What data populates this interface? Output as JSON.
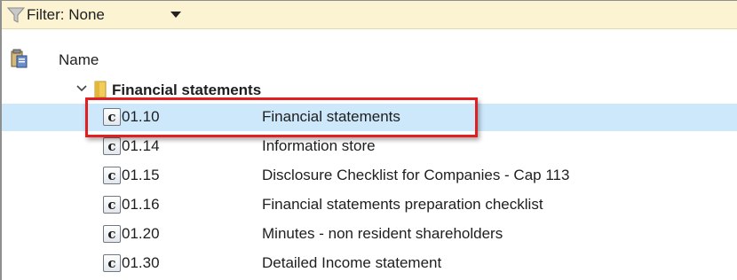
{
  "filter_bar": {
    "label": "Filter: None",
    "icon": "filter-icon"
  },
  "header": {
    "name_label": "Name",
    "icon": "clipboard-icon"
  },
  "group": {
    "label": "Financial statements",
    "icon": "folder-icon",
    "expanded": true
  },
  "rows": [
    {
      "code": "01.10",
      "name": "Financial statements",
      "icon": "c-document-icon",
      "selected": true
    },
    {
      "code": "01.14",
      "name": "Information store",
      "icon": "c-document-icon"
    },
    {
      "code": "01.15",
      "name": "Disclosure Checklist for Companies - Cap 113",
      "icon": "c-document-icon"
    },
    {
      "code": "01.16",
      "name": "Financial statements preparation checklist",
      "icon": "c-document-icon"
    },
    {
      "code": "01.20",
      "name": "Minutes - non resident shareholders",
      "icon": "c-document-icon"
    },
    {
      "code": "01.30",
      "name": "Detailed Income statement",
      "icon": "c-document-icon"
    }
  ],
  "icon_glyph": "c",
  "colors": {
    "filter_bar_bg": "#fbf3d1",
    "selected_row_bg": "#cde8fb",
    "highlight_border": "#e02020"
  }
}
